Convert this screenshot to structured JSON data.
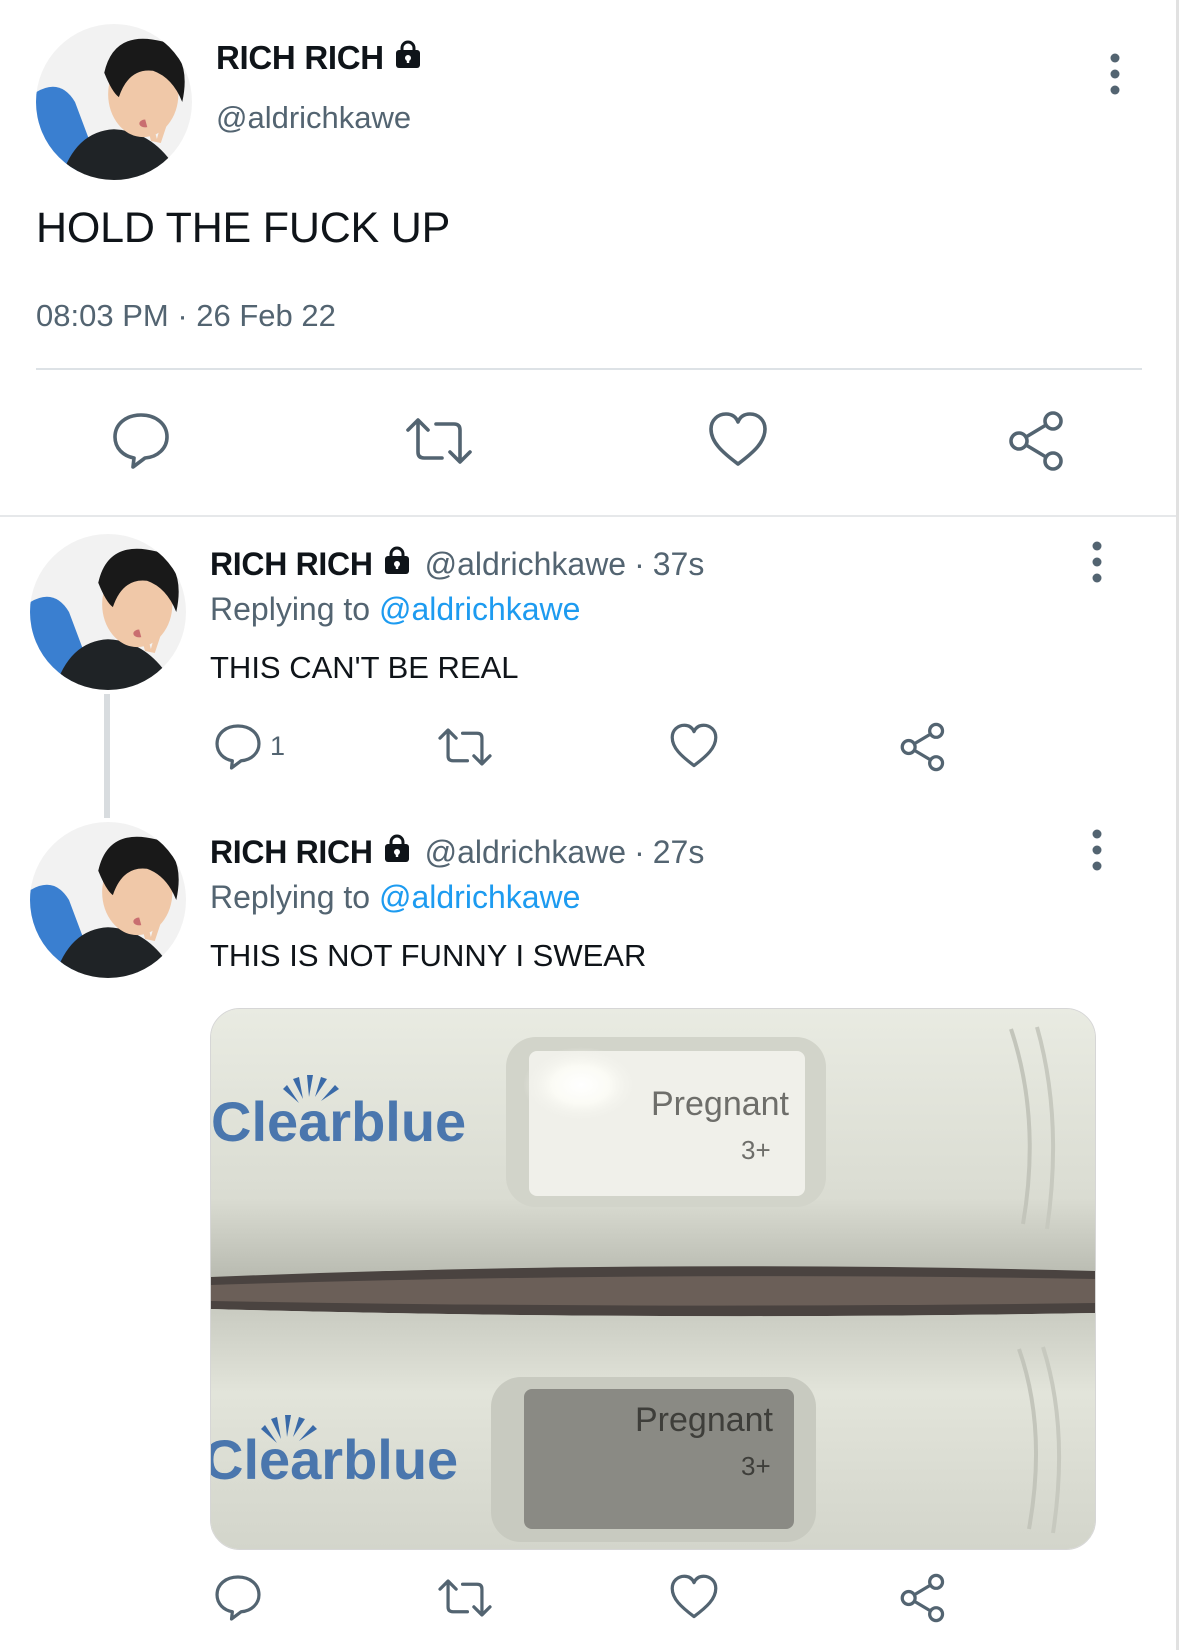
{
  "main_tweet": {
    "display_name": "RICH RICH",
    "handle": "@aldrichkawe",
    "text": "HOLD THE FUCK UP",
    "time": "08:03 PM",
    "date": "26 Feb 22",
    "meta_separator": "·",
    "avatar_icon": "profile-photo",
    "lock_icon": "lock-icon",
    "actions": [
      "comment-icon",
      "retweet-icon",
      "heart-icon",
      "share-icon"
    ]
  },
  "replies": [
    {
      "display_name": "RICH RICH",
      "handle": "@aldrichkawe",
      "separator": "·",
      "time_ago": "37s",
      "replying_prefix": "Replying to",
      "replying_handle": "@aldrichkawe",
      "text": "THIS CAN'T BE REAL",
      "reply_count": "1"
    },
    {
      "display_name": "RICH RICH",
      "handle": "@aldrichkawe",
      "separator": "·",
      "time_ago": "27s",
      "replying_prefix": "Replying to",
      "replying_handle": "@aldrichkawe",
      "text": "THIS IS NOT FUNNY I SWEAR",
      "media": {
        "kind": "photo",
        "brand_top": "Clearblue",
        "display_top_line1": "Pregnant",
        "display_top_line2": "3+",
        "brand_bottom": "Clearblue",
        "display_bottom_line1": "Pregnant",
        "display_bottom_line2": "3+"
      }
    }
  ],
  "colors": {
    "text": "#0f1419",
    "secondary": "#536471",
    "link": "#1d9bf0",
    "divider": "#dde2e6"
  }
}
